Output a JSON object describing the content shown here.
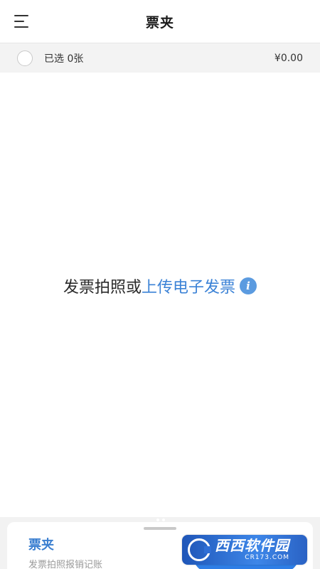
{
  "header": {
    "title": "票夹",
    "menu_icon": "menu-icon"
  },
  "select_bar": {
    "selected_text": "已选 0张",
    "amount": "¥0.00"
  },
  "empty_state": {
    "prompt_prefix": "发票拍照或",
    "prompt_link": "上传电子发票",
    "info_glyph": "i"
  },
  "bottom_sheet": {
    "title": "票夹",
    "subtitle": "发票拍照报销记账"
  },
  "watermark": {
    "main": "西西软件园",
    "sub": "CR173.COM"
  },
  "colors": {
    "accent": "#3b82d6",
    "select_bar_bg": "#f3f3f3",
    "sheet_bg": "#f2f2f2"
  }
}
